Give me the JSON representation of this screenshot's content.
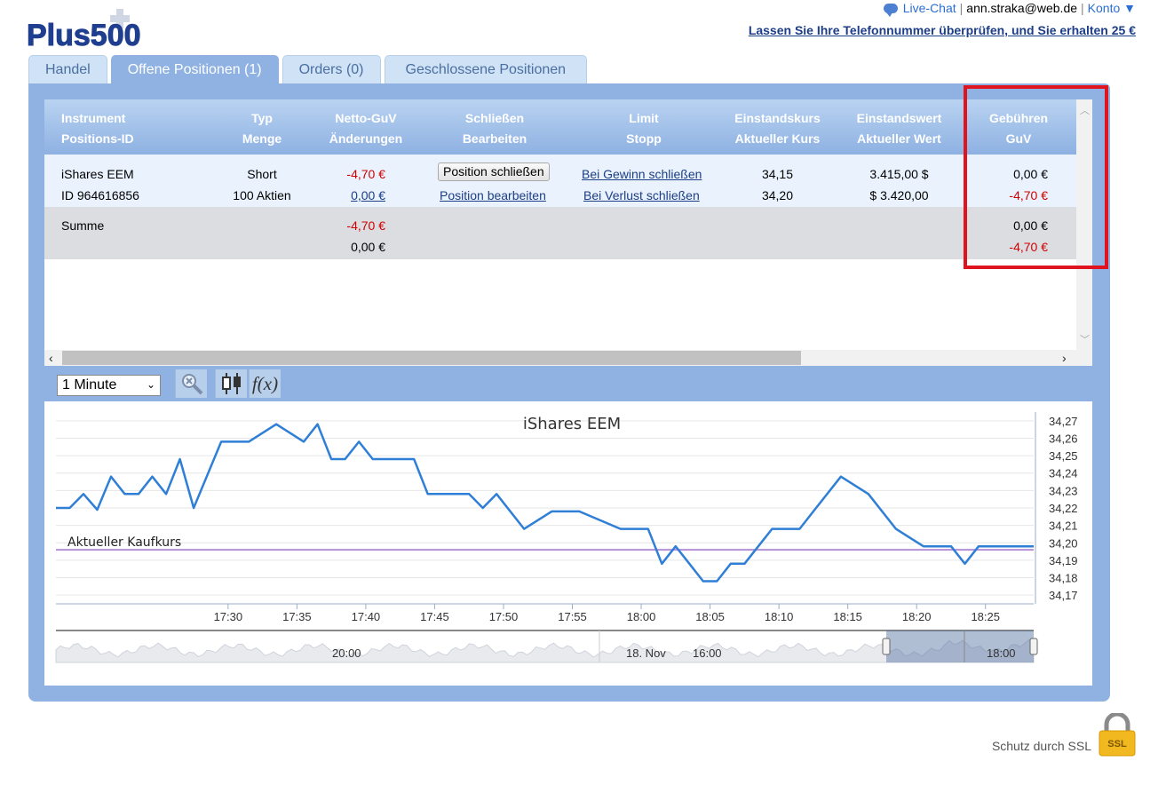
{
  "brand": {
    "logo_text": "Plus500"
  },
  "topbar": {
    "live_chat": "Live-Chat",
    "separator": "|",
    "email": "ann.straka@web.de",
    "account": "Konto ▼",
    "promo": "Lassen Sie Ihre Telefonnummer überprüfen, und Sie erhalten 25 €"
  },
  "tabs": [
    {
      "label": "Handel"
    },
    {
      "label": "Offene Positionen (1)"
    },
    {
      "label": "Orders (0)"
    },
    {
      "label": "Geschlossene Positionen"
    }
  ],
  "table": {
    "headers": [
      {
        "line1": "Instrument",
        "line2": "Positions-ID"
      },
      {
        "line1": "Typ",
        "line2": "Menge"
      },
      {
        "line1": "Netto-GuV",
        "line2": "Änderungen"
      },
      {
        "line1": "Schließen",
        "line2": "Bearbeiten"
      },
      {
        "line1": "Limit",
        "line2": "Stopp"
      },
      {
        "line1": "Einstandskurs",
        "line2": "Aktueller Kurs"
      },
      {
        "line1": "Einstandswert",
        "line2": "Aktueller Wert"
      },
      {
        "line1": "Gebühren",
        "line2": "GuV"
      }
    ],
    "position": {
      "instrument": "iShares EEM",
      "id": "ID 964616856",
      "type": "Short",
      "quantity": "100 Aktien",
      "net_pl": "-4,70 €",
      "changes": "0,00 €",
      "close_button": "Position schließen",
      "edit_link": "Position bearbeiten",
      "limit_link": "Bei Gewinn schließen",
      "stop_link": "Bei Verlust schließen",
      "entry_price": "34,15",
      "current_price": "34,20",
      "entry_value": "3.415,00 $",
      "current_value": "$ 3.420,00",
      "fees": "0,00 €",
      "pl": "-4,70 €"
    },
    "summary": {
      "label": "Summe",
      "net_pl": "-4,70 €",
      "changes": "0,00 €",
      "fees": "0,00 €",
      "pl": "-4,70 €"
    }
  },
  "toolbar": {
    "timeframe": "1 Minute",
    "tools": [
      "zoom-icon",
      "candlestick-icon",
      "function-icon"
    ],
    "function_label": "f(x)"
  },
  "chart_data": {
    "type": "line",
    "title": "iShares EEM",
    "reference_line": {
      "label": "Aktueller Kaufkurs",
      "value": 34.196,
      "color": "#b58fd6"
    },
    "series_color": "#2f7fd6",
    "x_ticks": [
      "17:30",
      "17:35",
      "17:40",
      "17:45",
      "17:50",
      "17:55",
      "18:00",
      "18:05",
      "18:10",
      "18:15",
      "18:20",
      "18:25"
    ],
    "y_ticks": [
      "34,27",
      "34,26",
      "34,25",
      "34,24",
      "34,23",
      "34,22",
      "34,21",
      "34,20",
      "34,19",
      "34,18",
      "34,17"
    ],
    "ylim": [
      34.165,
      34.275
    ],
    "xlim_minutes": [
      17.5,
      88.5
    ],
    "x_minutes": [
      17.5,
      18.5,
      19.5,
      20.5,
      21.5,
      22.5,
      23.5,
      24.5,
      25.5,
      26.5,
      27.5,
      29.5,
      31.5,
      33.5,
      35.5,
      36.5,
      37.5,
      38.5,
      39.5,
      40.5,
      41.5,
      42.5,
      43.5,
      44.5,
      45.5,
      46.5,
      47.5,
      48.5,
      49.5,
      51.5,
      53.5,
      55.5,
      58.5,
      60.5,
      61.5,
      62.5,
      63.5,
      64.5,
      65.5,
      66.5,
      67.5,
      68.5,
      69.5,
      70.5,
      71.5,
      72.5,
      74.5,
      76.5,
      78.5,
      80.5,
      81.5,
      82.5,
      83.5,
      84.5,
      85.5,
      86.5,
      87.5,
      88.5
    ],
    "values": [
      34.22,
      34.22,
      34.228,
      34.219,
      34.238,
      34.228,
      34.228,
      34.238,
      34.228,
      34.248,
      34.22,
      34.258,
      34.258,
      34.268,
      34.258,
      34.268,
      34.248,
      34.248,
      34.258,
      34.248,
      34.248,
      34.248,
      34.248,
      34.228,
      34.228,
      34.228,
      34.228,
      34.22,
      34.228,
      34.208,
      34.218,
      34.218,
      34.208,
      34.208,
      34.188,
      34.198,
      34.188,
      34.178,
      34.178,
      34.188,
      34.188,
      34.198,
      34.208,
      34.208,
      34.208,
      34.218,
      34.238,
      34.228,
      34.208,
      34.198,
      34.198,
      34.198,
      34.188,
      34.198,
      34.198,
      34.198,
      34.198,
      34.198
    ],
    "navigator_labels": [
      "20:00",
      "18. Nov",
      "16:00",
      "18:00"
    ]
  },
  "footer": {
    "ssl_text": "Schutz durch SSL",
    "ssl_badge": "SSL"
  }
}
